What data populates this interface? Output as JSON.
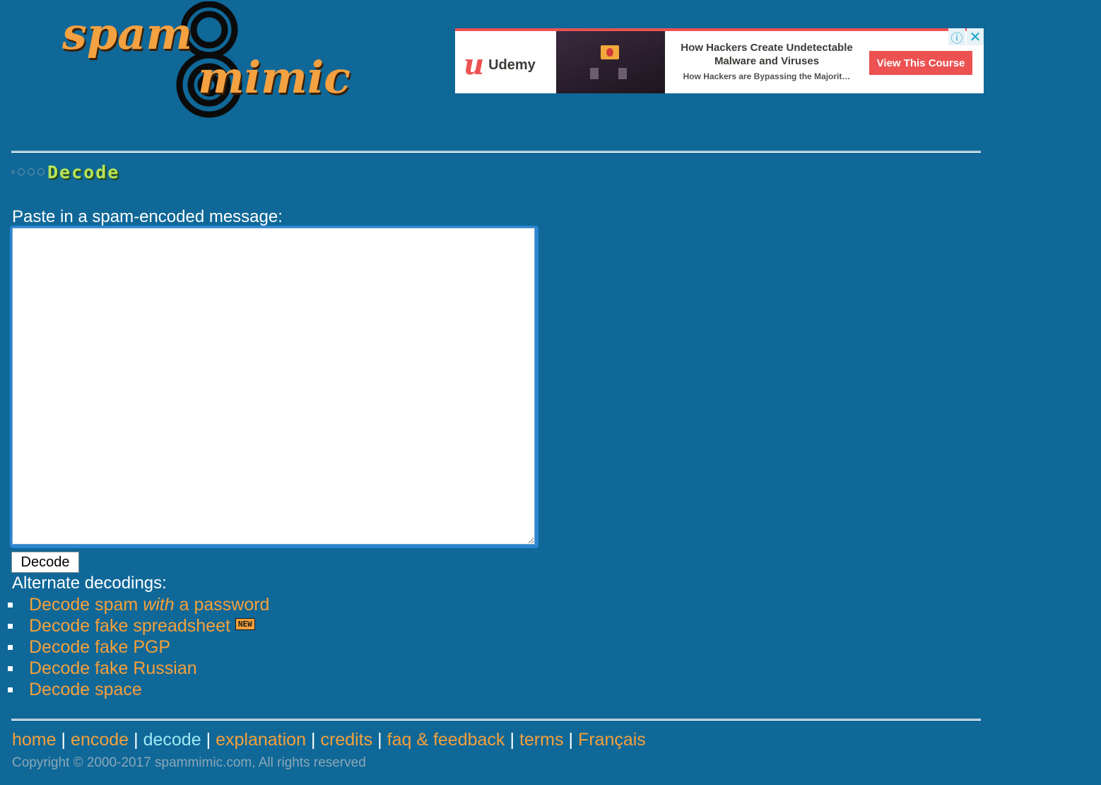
{
  "logo": {
    "line1": "spam",
    "line2": "mimic"
  },
  "ad": {
    "brand": "Udemy",
    "brand_mark": "u",
    "headline": "How Hackers Create Undetectable Malware and Viruses",
    "subline": "How Hackers are Bypassing the Majorit…",
    "cta": "View This Course",
    "info_icon": "ⓘ",
    "close_icon": "✕",
    "accent_color": "#ec5252"
  },
  "section": {
    "title": "Decode"
  },
  "form": {
    "prompt": "Paste in a spam-encoded message:",
    "message_value": "",
    "submit_label": "Decode"
  },
  "alternates": {
    "label": "Alternate decodings:",
    "items": [
      {
        "pre": "Decode spam ",
        "em": "with",
        "post": " a password"
      },
      {
        "text": "Decode fake spreadsheet",
        "badge": "NEW"
      },
      {
        "text": "Decode fake PGP"
      },
      {
        "text": "Decode fake Russian"
      },
      {
        "text": "Decode space"
      }
    ]
  },
  "footer": {
    "nav": [
      "home",
      "encode",
      "decode",
      "explanation",
      "credits",
      "faq & feedback",
      "terms",
      "Français"
    ],
    "separator": "|",
    "current": "decode",
    "copyright": "Copyright © 2000-2017 spammimic.com, All rights reserved"
  },
  "colors": {
    "background": "#0f6898",
    "link": "#f5a03a",
    "current_link": "#9ee8f5",
    "heading": "#b6e45a"
  }
}
